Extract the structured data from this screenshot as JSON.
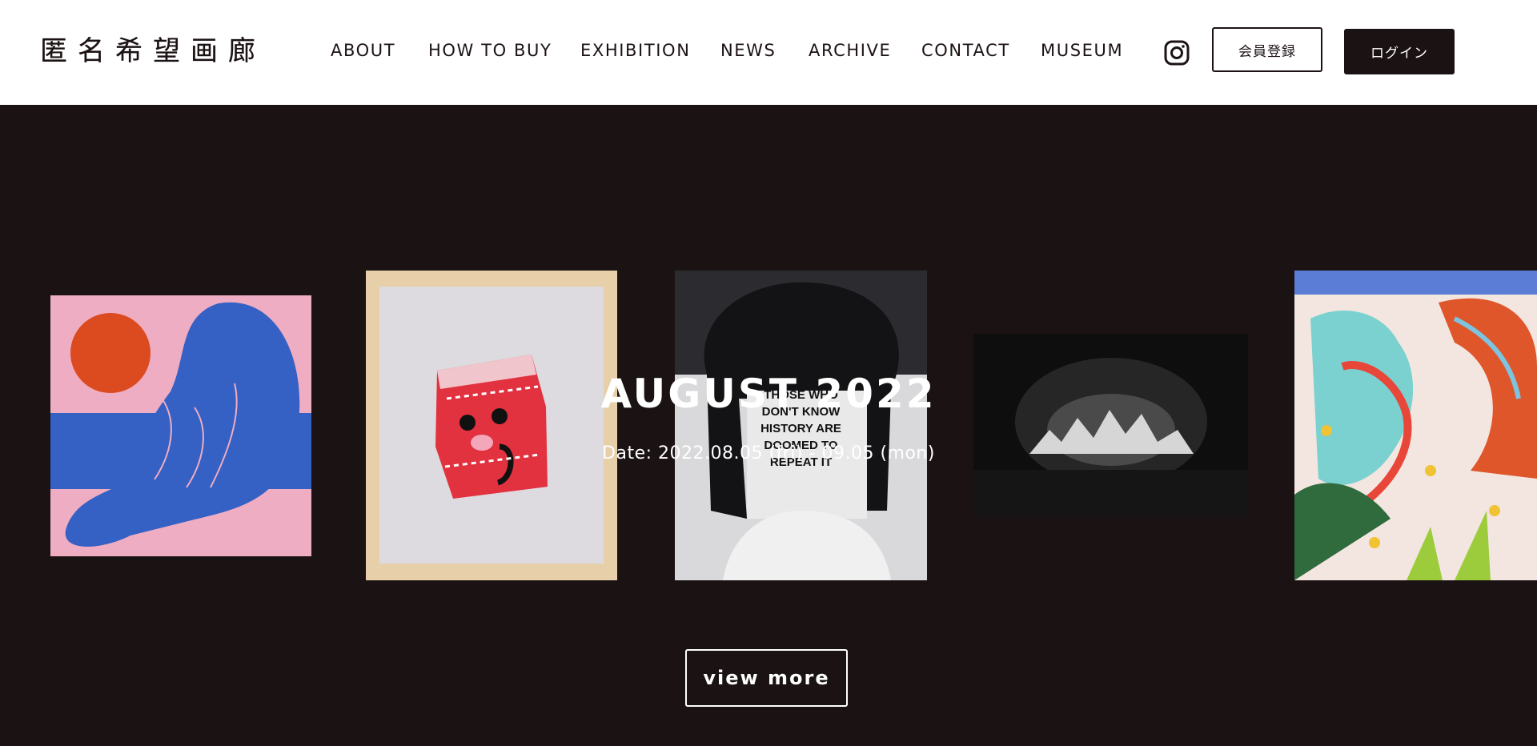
{
  "brand": {
    "logo_text": "匿名希望画廊"
  },
  "nav": {
    "items": [
      {
        "label": "ABOUT"
      },
      {
        "label": "HOW TO BUY"
      },
      {
        "label": "EXHIBITION"
      },
      {
        "label": "NEWS"
      },
      {
        "label": "ARCHIVE"
      },
      {
        "label": "CONTACT"
      },
      {
        "label": "MUSEUM"
      }
    ],
    "instagram_icon": "instagram-icon",
    "register_label": "会員登録",
    "login_label": "ログイン"
  },
  "hero": {
    "title": "AUGUST 2022",
    "date": "Date: 2022.08.05 (fri) - 09.05 (mon)",
    "view_more_label": "view more",
    "artwork3_text": [
      "THOSE WHO",
      "DON'T KNOW",
      "HISTORY ARE",
      "DOOMED TO",
      "REPEAT IT"
    ]
  },
  "colors": {
    "background": "#1b1213",
    "header": "#ffffff",
    "accent_dark": "#1b1213"
  }
}
